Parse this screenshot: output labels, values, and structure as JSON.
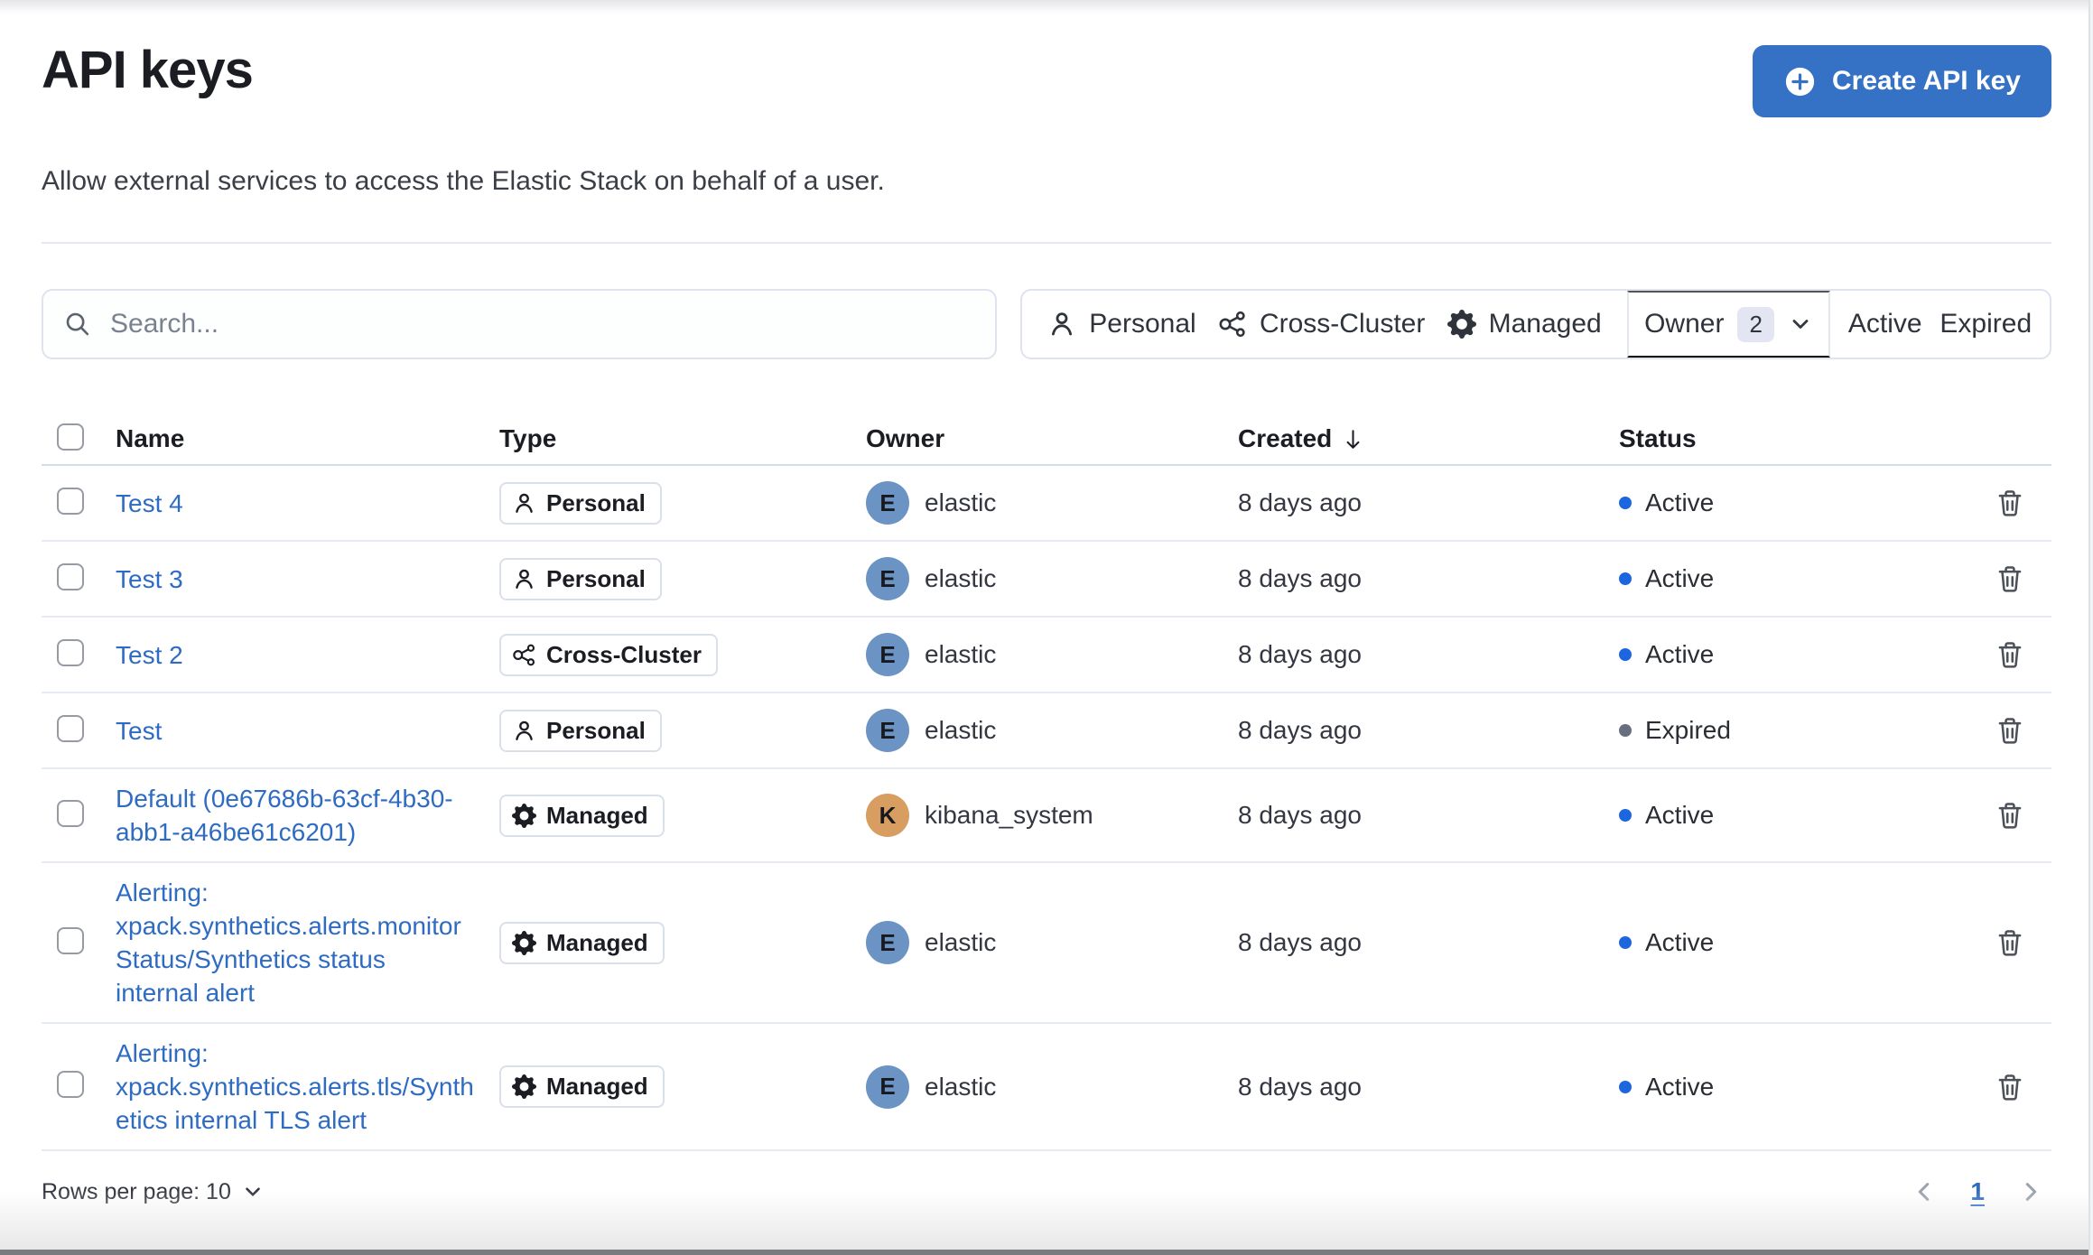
{
  "colors": {
    "primary_button": "#3571C4",
    "link": "#2E6BC3",
    "active_status_dot": "#1C66DF",
    "expired_status_dot": "#69707D",
    "avatar_elastic": "#6B93C3",
    "avatar_kibana_system": "#D79D61"
  },
  "page": {
    "title": "API keys",
    "subtitle": "Allow external services to access the Elastic Stack on behalf of a user.",
    "create_button_label": "Create API key"
  },
  "toolbar": {
    "search_placeholder": "Search...",
    "type_filters": [
      {
        "icon": "user-icon",
        "label": "Personal"
      },
      {
        "icon": "cluster-icon",
        "label": "Cross-Cluster"
      },
      {
        "icon": "gear-icon",
        "label": "Managed"
      }
    ],
    "owner_filter": {
      "label": "Owner",
      "count": "2"
    },
    "status_filters": [
      {
        "label": "Active"
      },
      {
        "label": "Expired"
      }
    ]
  },
  "table": {
    "columns": [
      {
        "label": "Name"
      },
      {
        "label": "Type"
      },
      {
        "label": "Owner"
      },
      {
        "label": "Created",
        "sort": "desc"
      },
      {
        "label": "Status"
      }
    ],
    "rows": [
      {
        "name": "Test 4",
        "type": "Personal",
        "owner": "elastic",
        "avatar_initial": "E",
        "created": "8 days ago",
        "status": "Active"
      },
      {
        "name": "Test 3",
        "type": "Personal",
        "owner": "elastic",
        "avatar_initial": "E",
        "created": "8 days ago",
        "status": "Active"
      },
      {
        "name": "Test 2",
        "type": "Cross-Cluster",
        "owner": "elastic",
        "avatar_initial": "E",
        "created": "8 days ago",
        "status": "Active"
      },
      {
        "name": "Test",
        "type": "Personal",
        "owner": "elastic",
        "avatar_initial": "E",
        "created": "8 days ago",
        "status": "Expired"
      },
      {
        "name": "Default (0e67686b-63cf-4b30-abb1-a46be61c6201)",
        "type": "Managed",
        "owner": "kibana_system",
        "avatar_initial": "K",
        "created": "8 days ago",
        "status": "Active"
      },
      {
        "name": "Alerting: xpack.synthetics.alerts.monitorStatus/Synthetics status internal alert",
        "type": "Managed",
        "owner": "elastic",
        "avatar_initial": "E",
        "created": "8 days ago",
        "status": "Active"
      },
      {
        "name": "Alerting: xpack.synthetics.alerts.tls/Synthetics internal TLS alert",
        "type": "Managed",
        "owner": "elastic",
        "avatar_initial": "E",
        "created": "8 days ago",
        "status": "Active"
      }
    ]
  },
  "footer": {
    "rows_per_page_label": "Rows per page: 10",
    "page_number": "1"
  }
}
